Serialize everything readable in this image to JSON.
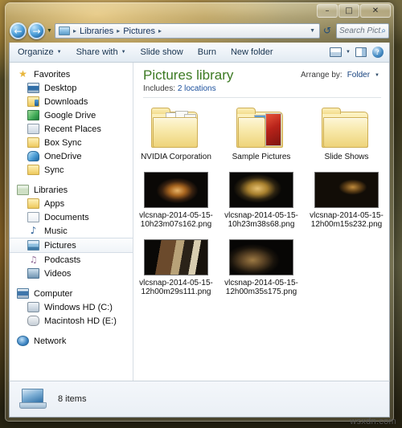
{
  "window": {
    "minimize_label": "–",
    "maximize_label": "□",
    "close_label": "✕"
  },
  "address_bar": {
    "back_label": "←",
    "forward_label": "→",
    "history_caret": "▼",
    "crumbs": [
      "Libraries",
      "Pictures"
    ],
    "separator": "▸",
    "dropdown_caret": "▼",
    "refresh_label": "↺"
  },
  "search": {
    "placeholder": "Search Pict...",
    "icon_label": "⌕"
  },
  "toolbar": {
    "organize": "Organize",
    "share_with": "Share with",
    "slide_show": "Slide show",
    "burn": "Burn",
    "new_folder": "New folder",
    "caret": "▼",
    "help_label": "?"
  },
  "sidebar": {
    "groups": [
      {
        "header": {
          "label": "Favorites",
          "icon": "star-icon"
        },
        "items": [
          {
            "label": "Desktop",
            "icon": "desktop-icon"
          },
          {
            "label": "Downloads",
            "icon": "downloads-icon"
          },
          {
            "label": "Google Drive",
            "icon": "google-drive-icon"
          },
          {
            "label": "Recent Places",
            "icon": "recent-places-icon"
          },
          {
            "label": "Box Sync",
            "icon": "folder-icon"
          },
          {
            "label": "OneDrive",
            "icon": "onedrive-icon"
          },
          {
            "label": "Sync",
            "icon": "folder-icon"
          }
        ]
      },
      {
        "header": {
          "label": "Libraries",
          "icon": "library-icon"
        },
        "items": [
          {
            "label": "Apps",
            "icon": "folder-icon"
          },
          {
            "label": "Documents",
            "icon": "document-icon"
          },
          {
            "label": "Music",
            "icon": "music-icon"
          },
          {
            "label": "Pictures",
            "icon": "pictures-icon",
            "selected": true
          },
          {
            "label": "Podcasts",
            "icon": "podcast-icon"
          },
          {
            "label": "Videos",
            "icon": "video-icon"
          }
        ]
      },
      {
        "header": {
          "label": "Computer",
          "icon": "computer-icon"
        },
        "items": [
          {
            "label": "Windows HD (C:)",
            "icon": "hard-drive-icon"
          },
          {
            "label": "Macintosh HD (E:)",
            "icon": "hard-drive-icon"
          }
        ]
      },
      {
        "header": {
          "label": "Network",
          "icon": "network-icon"
        },
        "items": []
      }
    ]
  },
  "content": {
    "library_title": "Pictures library",
    "includes_label": "Includes:",
    "includes_value": "2 locations",
    "arrange_label": "Arrange by:",
    "arrange_value": "Folder",
    "arrange_caret": "▼",
    "folders": [
      {
        "name": "NVIDIA Corporation",
        "icon": "folder-nvidia"
      },
      {
        "name": "Sample Pictures",
        "icon": "folder-sample-pictures"
      },
      {
        "name": "Slide Shows",
        "icon": "folder-slide-shows"
      }
    ],
    "files": [
      {
        "name": "vlcsnap-2014-05-15-10h23m07s162.png",
        "thumb": "th-a"
      },
      {
        "name": "vlcsnap-2014-05-15-10h23m38s68.png",
        "thumb": "th-b"
      },
      {
        "name": "vlcsnap-2014-05-15-12h00m15s232.png",
        "thumb": "th-c"
      },
      {
        "name": "vlcsnap-2014-05-15-12h00m29s111.png",
        "thumb": "th-d"
      },
      {
        "name": "vlcsnap-2014-05-15-12h00m35s175.png",
        "thumb": "th-e"
      }
    ]
  },
  "status": {
    "item_count": "8 items"
  },
  "watermark": {
    "text": "wsxdn.com"
  },
  "colors": {
    "library_title": "#3c7a23",
    "link": "#1a4f9c",
    "crumb_text": "#15325c",
    "glass_gold": "#d6a340"
  }
}
